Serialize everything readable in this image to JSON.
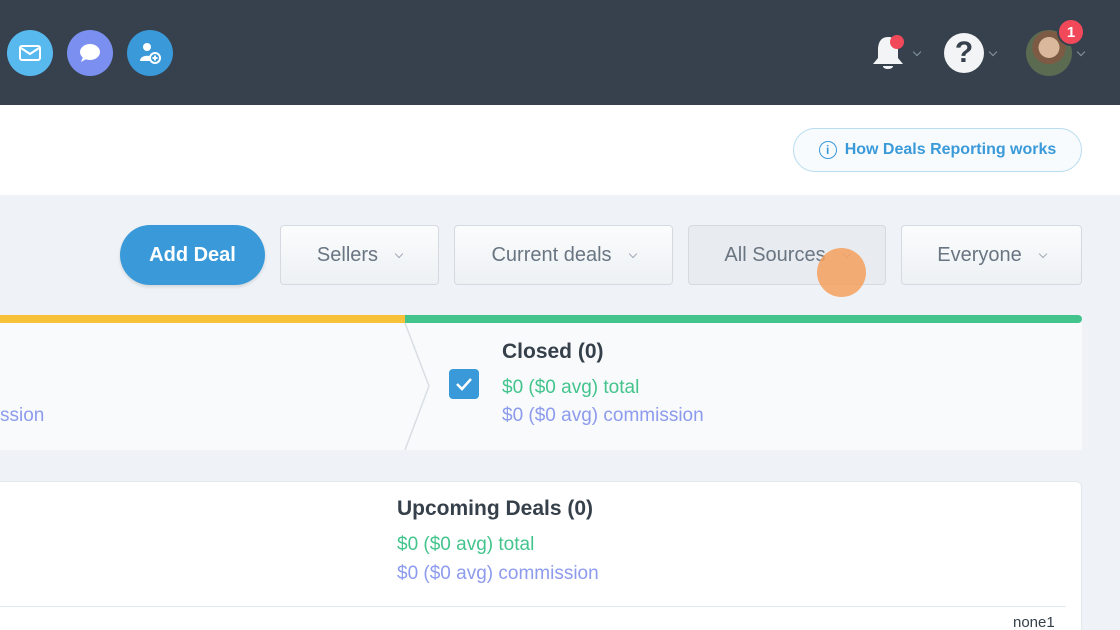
{
  "topbar": {
    "icons": [
      "mail-icon",
      "chat-icon",
      "user-add-icon"
    ],
    "notification_badge": "1"
  },
  "help_link": "How Deals Reporting works",
  "toolbar": {
    "add_deal": "Add Deal",
    "filters": [
      "Sellers",
      "Current deals",
      "All Sources",
      "Everyone"
    ]
  },
  "stages": {
    "left_partial": "ssion",
    "closed": {
      "title": "Closed (0)",
      "total": "$0 ($0 avg) total",
      "commission": "$0 ($0 avg) commission",
      "checked": true
    }
  },
  "upcoming": {
    "title": "Upcoming Deals (0)",
    "total": "$0 ($0 avg) total",
    "commission": "$0 ($0 avg) commission",
    "row_label": "none1"
  },
  "colors": {
    "topbar": "#36414d",
    "accent": "#3a9ad9",
    "green": "#44c48d",
    "yellow": "#f7c23a",
    "purple": "#8d9bed",
    "badge": "#f2495a"
  }
}
